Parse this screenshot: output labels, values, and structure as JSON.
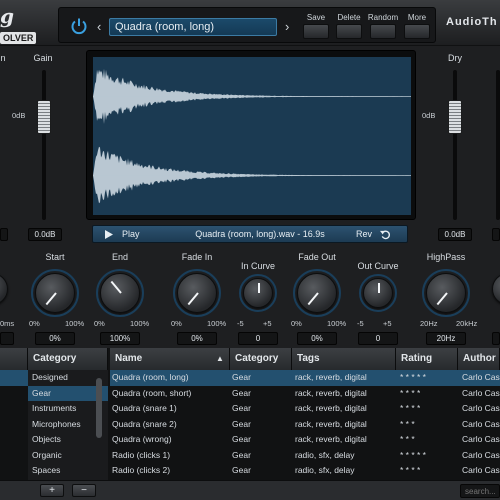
{
  "header": {
    "logo_glyph": "g",
    "logo_sub": "OLVER",
    "preset_name": "Quadra (room, long)",
    "nav_prev": "‹",
    "nav_next": "›",
    "buttons": [
      "Save",
      "Delete",
      "Random",
      "More"
    ],
    "brand": "AudioTh",
    "icons": [
      "power-icon"
    ]
  },
  "left_panel": {
    "gain_label": "Gain",
    "gain_db_mark": "0dB",
    "gain_value": "0.0dB",
    "partial_label": "n",
    "partial_time": "0ms"
  },
  "right_panel": {
    "dry_label": "Dry",
    "dry_db_mark": "0dB",
    "dry_value": "0.0dB"
  },
  "transport": {
    "play_label": "Play",
    "file_label": "Quadra (room, long).wav - 16.9s",
    "rev_label": "Rev",
    "icons": [
      "play-icon",
      "reverse-icon"
    ]
  },
  "knobs": [
    {
      "title": "Start",
      "min": "0%",
      "max": "100%",
      "value": "0%"
    },
    {
      "title": "End",
      "min": "0%",
      "max": "100%",
      "value": "100%"
    },
    {
      "title": "Fade In",
      "min": "0%",
      "max": "100%",
      "value": "0%"
    },
    {
      "title": "In Curve",
      "min": "-5",
      "max": "+5",
      "value": "0"
    },
    {
      "title": "Fade Out",
      "min": "0%",
      "max": "100%",
      "value": "0%"
    },
    {
      "title": "Out Curve",
      "min": "-5",
      "max": "+5",
      "value": "0"
    },
    {
      "title": "HighPass",
      "min": "20Hz",
      "max": "20kHz",
      "value": "20Hz"
    }
  ],
  "browser": {
    "category_header": "Category",
    "categories": [
      "Designed",
      "Gear",
      "Instruments",
      "Microphones",
      "Objects",
      "Organic",
      "Spaces"
    ],
    "selected_category": "Gear",
    "columns": {
      "name": "Name",
      "sort_indicator": "▲",
      "category": "Category",
      "tags": "Tags",
      "rating": "Rating",
      "author": "Author"
    },
    "rows": [
      {
        "name": "Quadra (room, long)",
        "category": "Gear",
        "tags": "rack, reverb, digital",
        "rating": "* * * * *",
        "author": "Carlo Cas"
      },
      {
        "name": "Quadra (room, short)",
        "category": "Gear",
        "tags": "rack, reverb, digital",
        "rating": "* * * *",
        "author": "Carlo Cas"
      },
      {
        "name": "Quadra (snare 1)",
        "category": "Gear",
        "tags": "rack, reverb, digital",
        "rating": "* * * *",
        "author": "Carlo Cas"
      },
      {
        "name": "Quadra (snare 2)",
        "category": "Gear",
        "tags": "rack, reverb, digital",
        "rating": "* * *",
        "author": "Carlo Cas"
      },
      {
        "name": "Quadra (wrong)",
        "category": "Gear",
        "tags": "rack, reverb, digital",
        "rating": "* * *",
        "author": "Carlo Cas"
      },
      {
        "name": "Radio (clicks 1)",
        "category": "Gear",
        "tags": "radio, sfx, delay",
        "rating": "* * * * *",
        "author": "Carlo Cas"
      },
      {
        "name": "Radio (clicks 2)",
        "category": "Gear",
        "tags": "radio, sfx, delay",
        "rating": "* * * *",
        "author": "Carlo Cas"
      }
    ],
    "selected_row": 0
  },
  "footer": {
    "add_label": "+",
    "remove_label": "−",
    "search_placeholder": "search..."
  },
  "colors": {
    "accent": "#23506f",
    "display_bg": "#1b3a52",
    "waveform": "#b9c7d2"
  },
  "waveform": {
    "channels": 2,
    "decay_rate": 6.5,
    "peak_amplitude": 0.95
  }
}
